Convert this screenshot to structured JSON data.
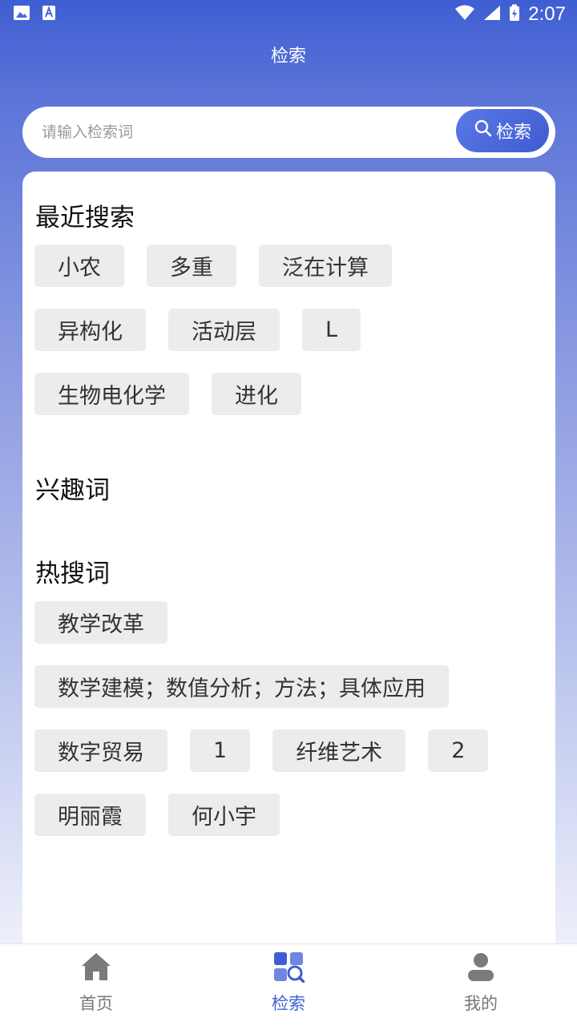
{
  "status_bar": {
    "time": "2:07"
  },
  "header": {
    "title": "检索"
  },
  "search": {
    "placeholder": "请输入检索词",
    "button_label": "检索"
  },
  "recent": {
    "title": "最近搜索",
    "rows": [
      [
        "小农",
        "多重",
        "泛在计算"
      ],
      [
        "异构化",
        "活动层",
        "L"
      ],
      [
        "生物电化学",
        "进化"
      ]
    ]
  },
  "interest": {
    "title": "兴趣词"
  },
  "hot": {
    "title": "热搜词",
    "rows": [
      [
        "教学改革"
      ],
      [
        "数学建模；数值分析；方法；具体应用"
      ],
      [
        "数字贸易",
        "1",
        "纤维艺术",
        "2"
      ],
      [
        "明丽霞",
        "何小宇"
      ]
    ]
  },
  "tabbar": {
    "items": [
      {
        "label": "首页",
        "icon": "home-icon",
        "active": false
      },
      {
        "label": "检索",
        "icon": "search-grid-icon",
        "active": true
      },
      {
        "label": "我的",
        "icon": "user-icon",
        "active": false
      }
    ]
  },
  "colors": {
    "accent": "#3f5ed3",
    "tag_bg": "#ececec",
    "inactive": "#7a7a7a"
  }
}
